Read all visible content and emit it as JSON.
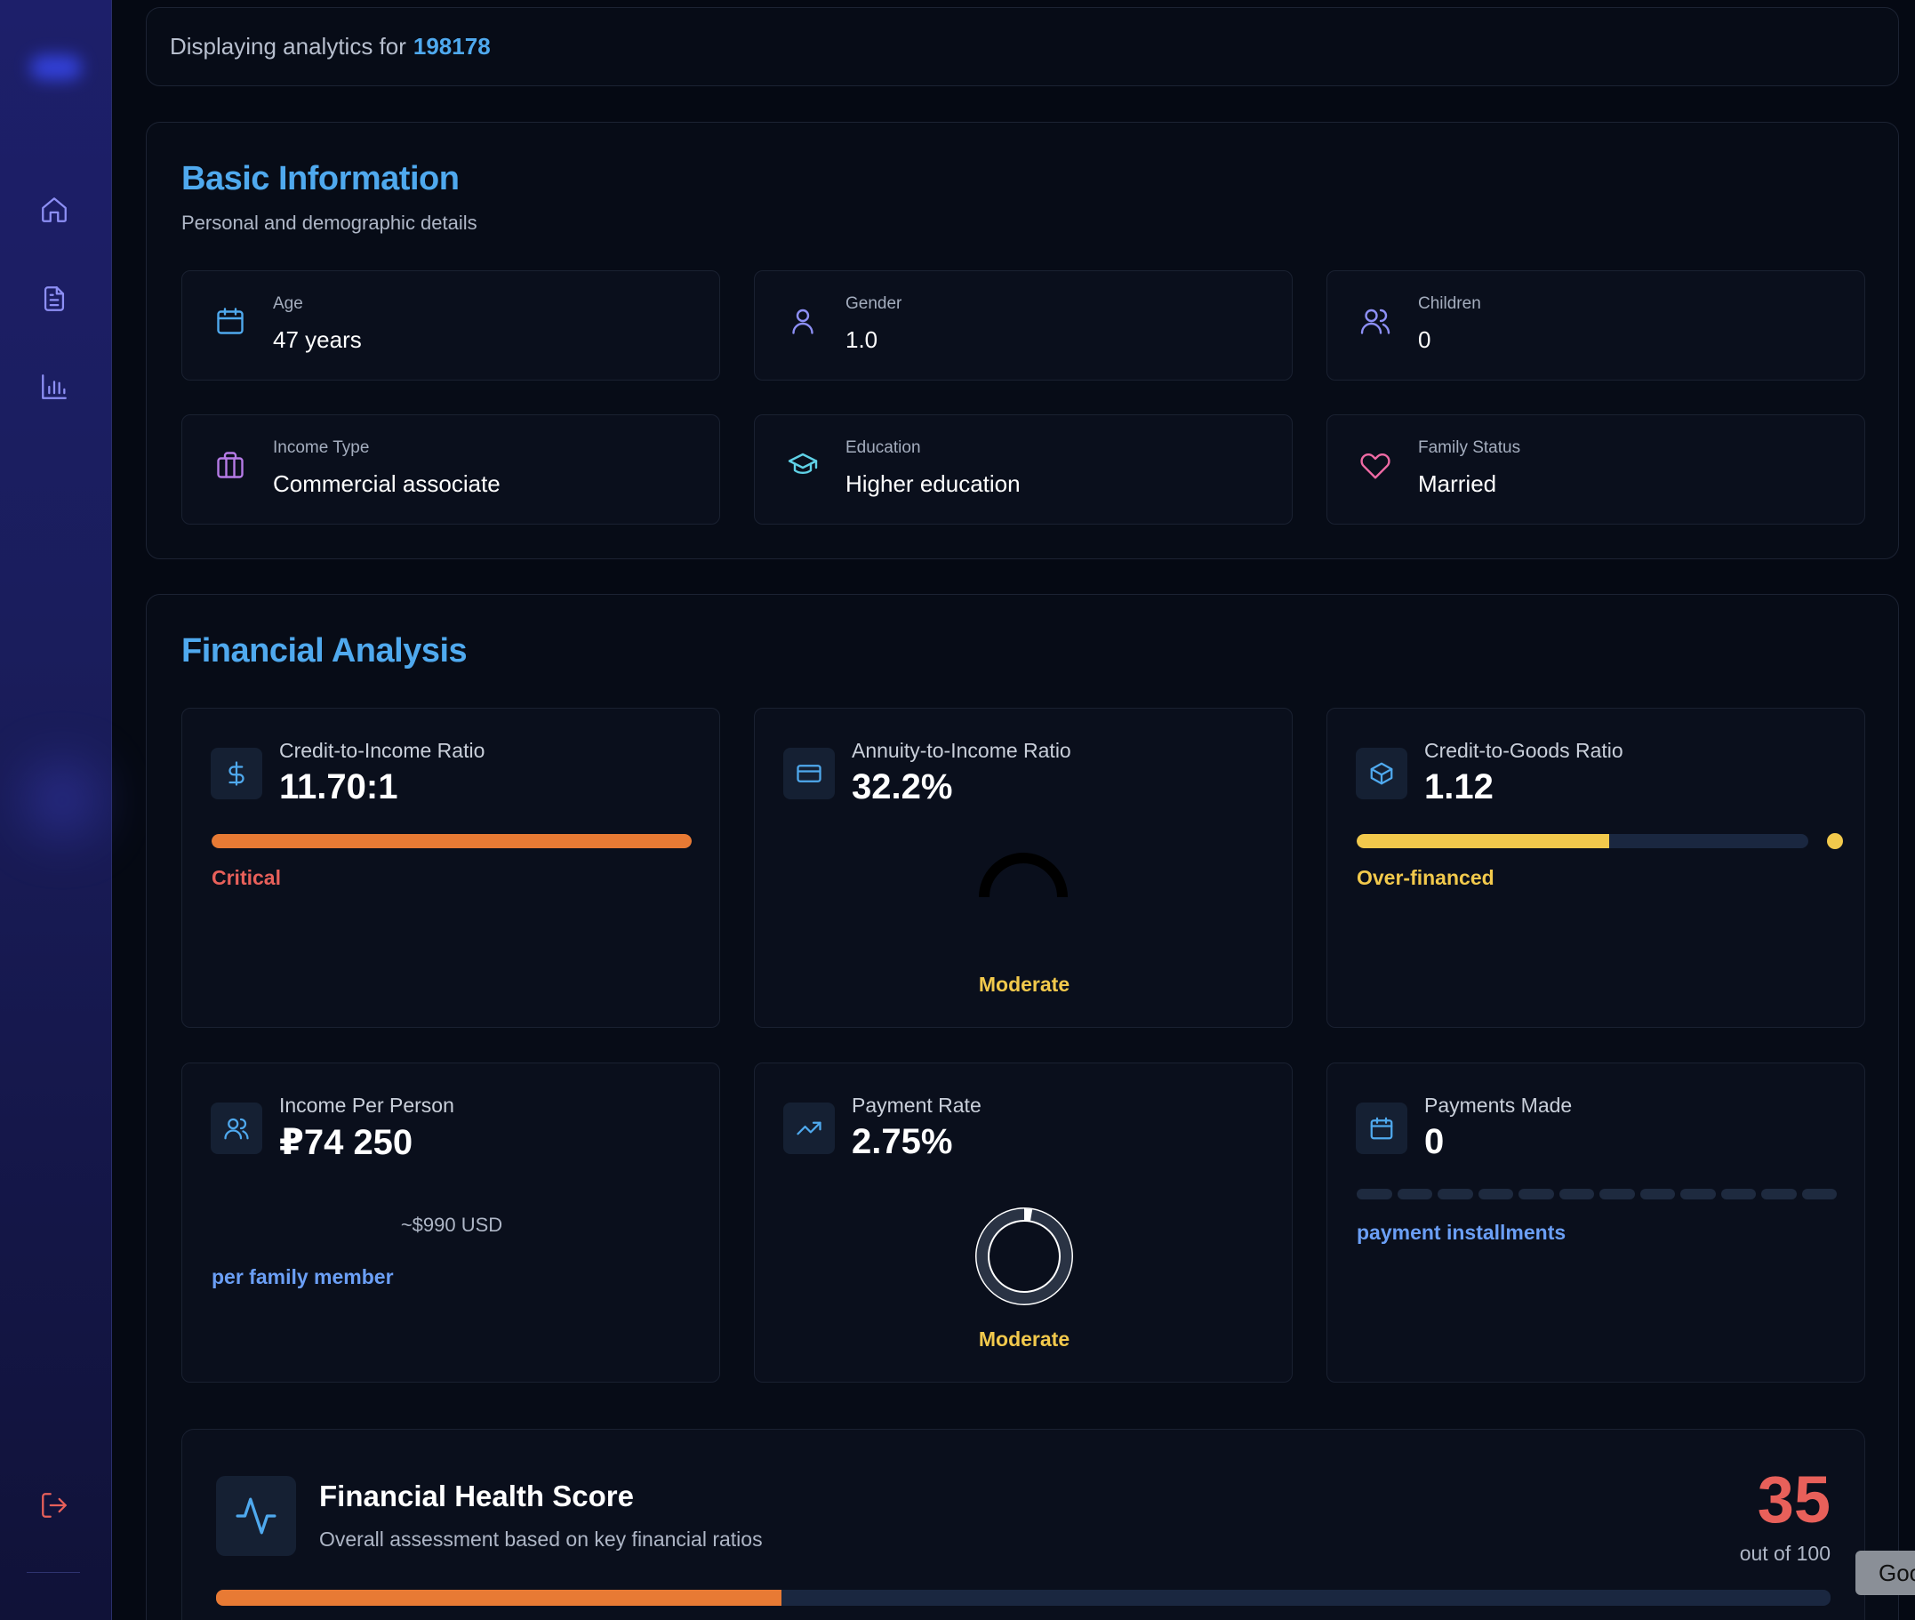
{
  "header": {
    "prefix": "Displaying analytics for",
    "id": "198178"
  },
  "sidebar": {
    "items": [
      {
        "name": "home",
        "icon": "home-icon"
      },
      {
        "name": "documents",
        "icon": "document-icon"
      },
      {
        "name": "analytics",
        "icon": "bar-chart-icon"
      }
    ],
    "logout_icon": "logout-icon"
  },
  "basic": {
    "title": "Basic Information",
    "subtitle": "Personal and demographic details",
    "items": [
      {
        "label": "Age",
        "value": "47 years",
        "icon": "calendar-icon",
        "color": "#4fa9ee"
      },
      {
        "label": "Gender",
        "value": "1.0",
        "icon": "user-icon",
        "color": "#8d8ff5"
      },
      {
        "label": "Children",
        "value": "0",
        "icon": "users-icon",
        "color": "#8d8ff5"
      },
      {
        "label": "Income Type",
        "value": "Commercial associate",
        "icon": "briefcase-icon",
        "color": "#b67be6"
      },
      {
        "label": "Education",
        "value": "Higher education",
        "icon": "graduation-cap-icon",
        "color": "#5fd1e6"
      },
      {
        "label": "Family Status",
        "value": "Married",
        "icon": "heart-icon",
        "color": "#ef6aa4"
      }
    ]
  },
  "financial": {
    "title": "Financial Analysis",
    "cards": [
      {
        "label": "Credit-to-Income Ratio",
        "value": "11.70:1",
        "status": "Critical",
        "status_color": "#e8605a",
        "bar_pct": 100,
        "bar_color": "#e87a34",
        "icon": "dollar-icon"
      },
      {
        "label": "Annuity-to-Income Ratio",
        "value": "32.2%",
        "status": "Moderate",
        "status_color": "#f2c94c",
        "icon": "credit-card-icon"
      },
      {
        "label": "Credit-to-Goods Ratio",
        "value": "1.12",
        "status": "Over-financed",
        "status_color": "#f2c94c",
        "bar_pct": 56,
        "bar_color": "#f2c94c",
        "icon": "box-icon"
      },
      {
        "label": "Income Per Person",
        "value": "₽74 250",
        "usd": "~$990 USD",
        "note": "per family member",
        "note_color": "#6b9ff6",
        "icon": "users-icon"
      },
      {
        "label": "Payment Rate",
        "value": "2.75%",
        "status": "Moderate",
        "status_color": "#f2c94c",
        "ring_pct": 2.75,
        "icon": "trending-up-icon"
      },
      {
        "label": "Payments Made",
        "value": "0",
        "note": "payment installments",
        "note_color": "#6b9ff6",
        "segments": 12,
        "icon": "calendar-icon"
      }
    ]
  },
  "health": {
    "title": "Financial Health Score",
    "subtitle": "Overall assessment based on key financial ratios",
    "score": "35",
    "out_of": "out of 100",
    "score_pct": 35,
    "bar_color": "#e87a34"
  },
  "toast": {
    "label": "Goo"
  }
}
